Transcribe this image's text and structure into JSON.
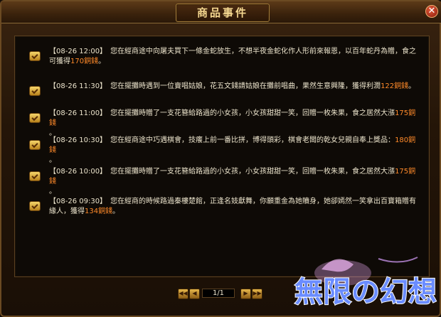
{
  "window": {
    "title": "商品事件"
  },
  "close_label": "✕",
  "events": [
    {
      "time": "【08-26 12:00】",
      "line1": "您在經商途中向屠夫買下一條金蛇放生，不想半夜金蛇化作人形前來報恩，以百年蛇丹為贈，食之",
      "line2_pre": "可獲得",
      "amount": "170銅錢",
      "line2_post": "。"
    },
    {
      "time": "【08-26 11:30】",
      "line1_pre": "您在擺攤時遇到一位賣唱姑娘，花五文錢請姑娘在攤前唱曲，果然生意興隆，獲得利潤",
      "amount": "122銅錢",
      "line1_post": "。"
    },
    {
      "time": "【08-26 11:00】",
      "line1_pre": "您在擺攤時贈了一支花簪給路過的小女孩，小女孩甜甜一笑，回贈一枚朱果，食之居然大漲",
      "amount": "175銅錢",
      "line2": "。"
    },
    {
      "time": "【08-26 10:30】",
      "line1_pre": "您在經商途中巧遇棋會，技癢上前一番比拼，博得頭彩，棋會老闆的乾女兒親自奉上獎品：",
      "amount": "180銅錢",
      "line2": "。"
    },
    {
      "time": "【08-26 10:00】",
      "line1_pre": "您在擺攤時贈了一支花簪給路過的小女孩，小女孩甜甜一笑，回贈一枚朱果，食之居然大漲",
      "amount": "175銅錢",
      "line2": "。"
    },
    {
      "time": "【08-26 09:30】",
      "line1": "您在經商的時候路過秦樓楚館，正逢名妓獻舞，你願重金為她贖身，她卻嫣然一笑拿出百寶箱贈有",
      "line2_pre": "緣人，獲得",
      "amount": "134銅錢",
      "line2_post": "。"
    }
  ],
  "pager": {
    "first": "◀◀",
    "prev": "◀",
    "page": "1/1",
    "next": "▶",
    "last": "▶▶"
  },
  "logo": {
    "text": "無限の幻想"
  },
  "colors": {
    "amount": "#ff8a2a",
    "text": "#ece4cc",
    "title": "#f5d890",
    "border": "#6b4a22"
  }
}
